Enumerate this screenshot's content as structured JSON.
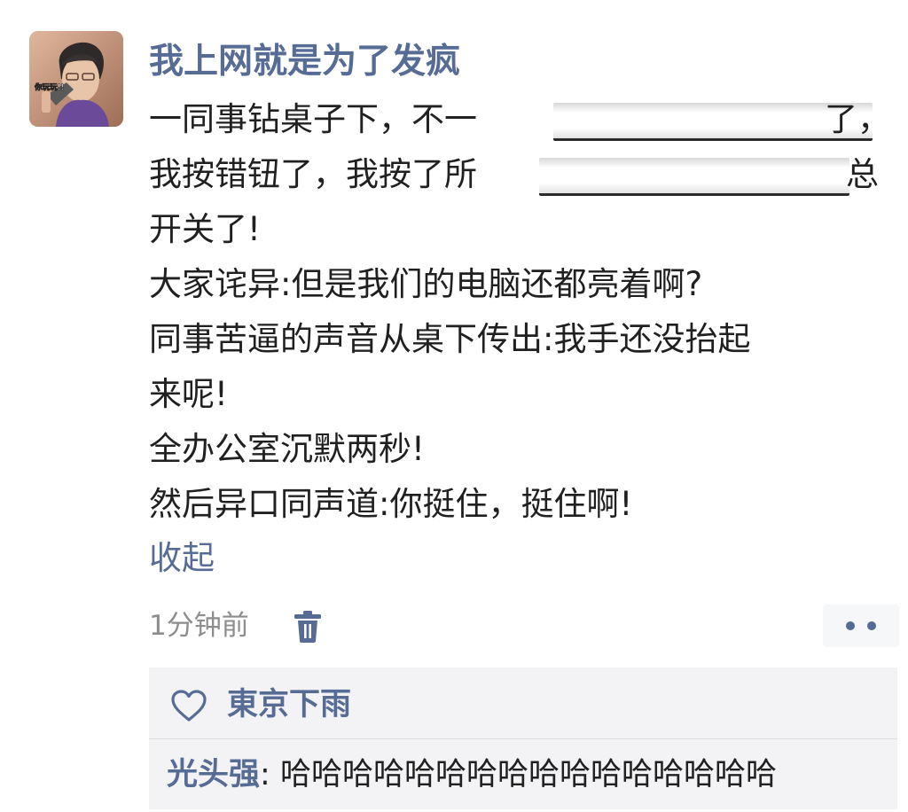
{
  "post": {
    "avatar_caption": "你玩玩!!",
    "username": "我上网就是为了发疯",
    "lines": [
      "一同事钻桌子下，不一",
      "了，",
      "我按错钮了，我按了所",
      "总",
      "开关了!",
      "大家诧异:但是我们的电脑还都亮着啊?",
      "同事苦逼的声音从桌下传出:我手还没抬起",
      "来呢!",
      "全办公室沉默两秒!",
      "然后异口同声道:你挺住，挺住啊!"
    ],
    "collapse_label": "收起",
    "timestamp": "1分钟前",
    "delete_icon": "trash-icon",
    "more_icon": "more-dots-icon"
  },
  "interaction": {
    "like_icon": "heart-outline-icon",
    "likes": [
      "東京下雨"
    ],
    "comment": {
      "author": "光头强",
      "separator": ": ",
      "text": "哈哈哈哈哈哈哈哈哈哈哈哈哈哈哈哈"
    }
  },
  "colors": {
    "link_blue": "#566c95",
    "text": "#202020",
    "muted": "#8d8d8d",
    "panel_bg": "#f3f3f5"
  }
}
